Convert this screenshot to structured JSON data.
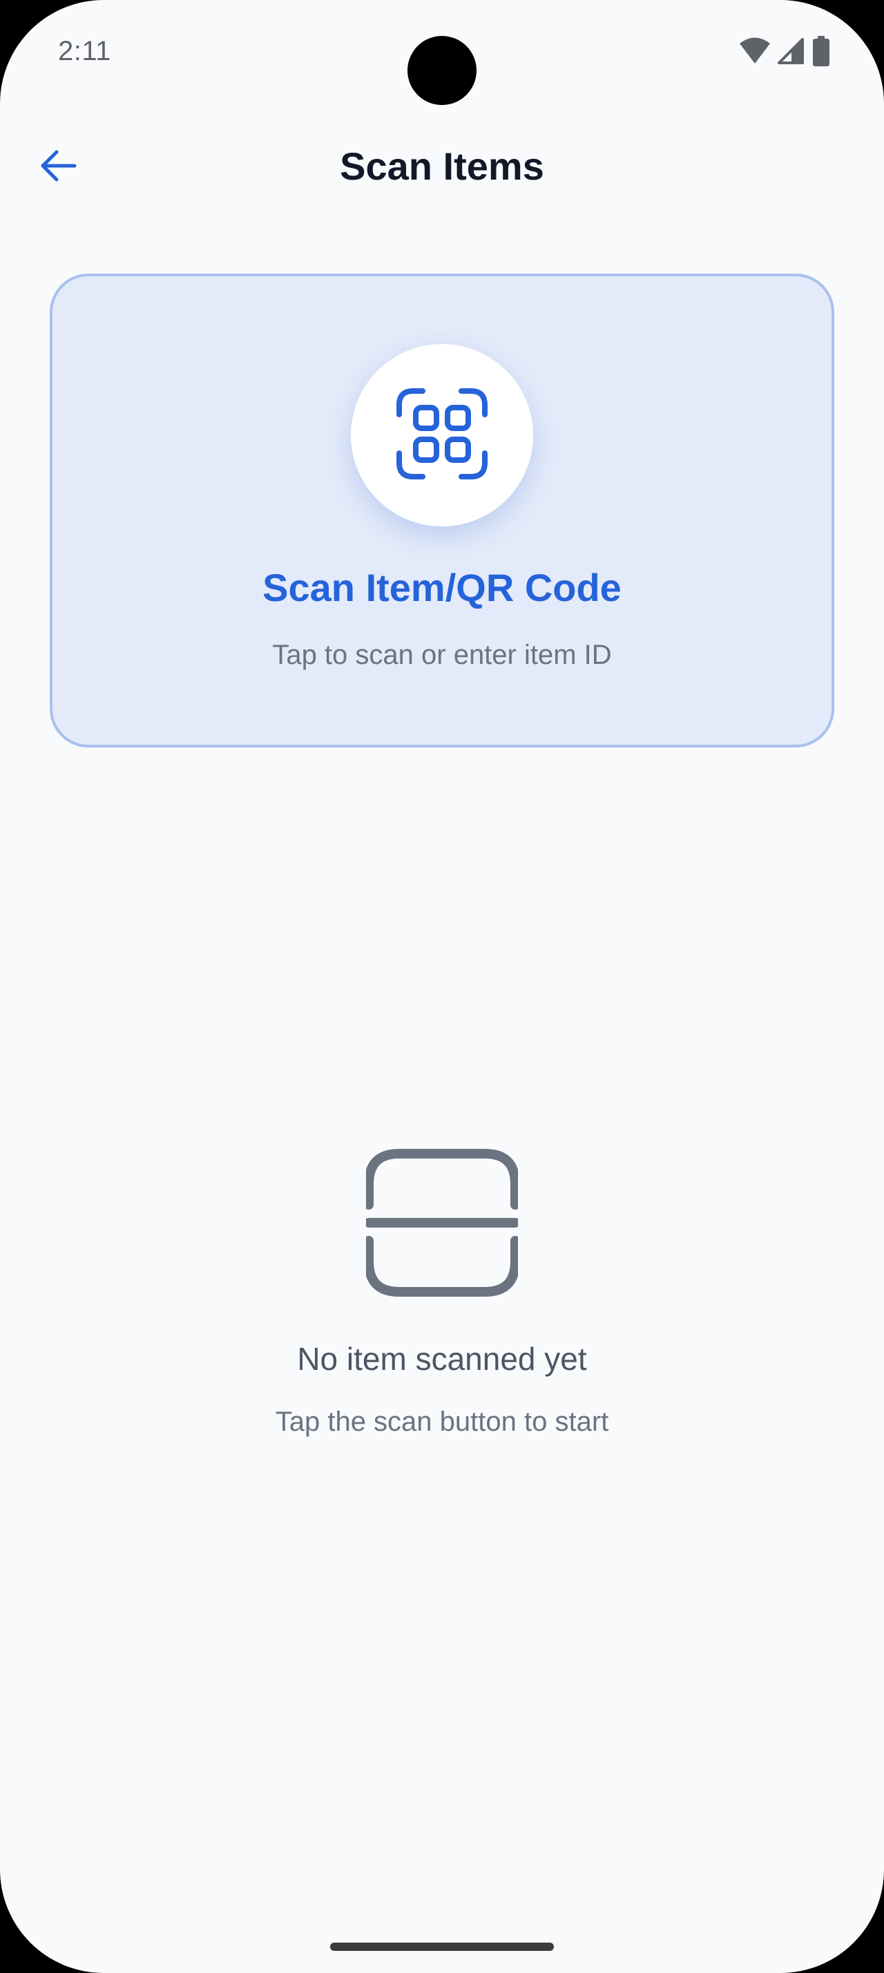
{
  "status_bar": {
    "time": "2:11",
    "icons": [
      "wifi-icon",
      "signal-icon",
      "battery-icon"
    ]
  },
  "app_bar": {
    "back_icon": "arrow-left-icon",
    "title": "Scan Items"
  },
  "scan_card": {
    "icon": "qr-scan-icon",
    "title": "Scan Item/QR Code",
    "subtitle": "Tap to scan or enter item ID"
  },
  "empty_state": {
    "icon": "scan-line-icon",
    "title": "No item scanned yet",
    "subtitle": "Tap the scan button to start"
  },
  "colors": {
    "accent": "#2563d9",
    "card_background": "#e3eaf9",
    "card_border": "#a9c0ef",
    "page_background": "#f8fafc",
    "muted_icon": "#6b7280"
  }
}
